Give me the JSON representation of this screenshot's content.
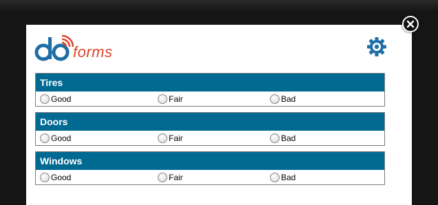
{
  "app": {
    "logo_text": "forms",
    "logo_lettering": "do"
  },
  "colors": {
    "header_bg": "#006a92",
    "logo_blue": "#1f6fa6",
    "logo_red": "#e0432a"
  },
  "icons": {
    "close": "close-icon",
    "settings": "gear-icon",
    "radio": "radio-icon"
  },
  "sections": [
    {
      "title": "Tires",
      "options": [
        "Good",
        "Fair",
        "Bad"
      ]
    },
    {
      "title": "Doors",
      "options": [
        "Good",
        "Fair",
        "Bad"
      ]
    },
    {
      "title": "Windows",
      "options": [
        "Good",
        "Fair",
        "Bad"
      ]
    }
  ]
}
